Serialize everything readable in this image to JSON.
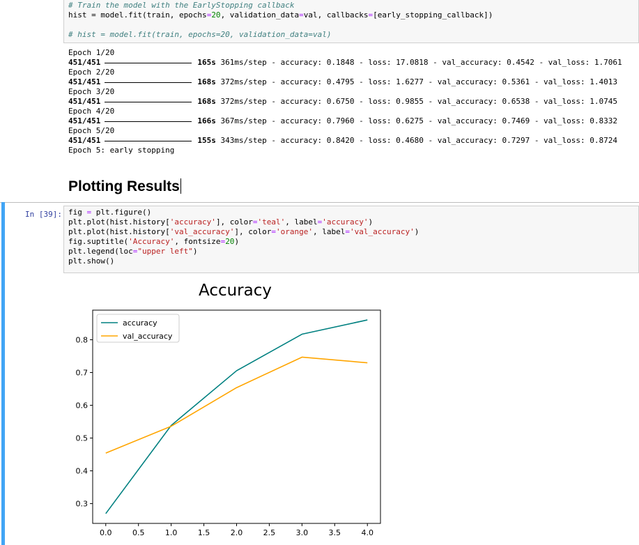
{
  "top_cell": {
    "comment1": "# Train the model with the EarlyStopping callback",
    "line2_a": "hist = model.fit(train, epochs",
    "line2_eq": "=",
    "line2_num": "20",
    "line2_b": ", validation_data",
    "line2_eq2": "=",
    "line2_c": "val, callbacks",
    "line2_eq3": "=",
    "line2_d": "[early_stopping_callback])",
    "comment2": "# hist = model.fit(train, epochs=20, validation_data=val)"
  },
  "output": {
    "epochs": [
      {
        "header": "Epoch 1/20",
        "steps": "451/451",
        "time": "165s",
        "rest": " 361ms/step - accuracy: 0.1848 - loss: 17.0818 - val_accuracy: 0.4542 - val_loss: 1.7061"
      },
      {
        "header": "Epoch 2/20",
        "steps": "451/451",
        "time": "168s",
        "rest": " 372ms/step - accuracy: 0.4795 - loss: 1.6277 - val_accuracy: 0.5361 - val_loss: 1.4013"
      },
      {
        "header": "Epoch 3/20",
        "steps": "451/451",
        "time": "168s",
        "rest": " 372ms/step - accuracy: 0.6750 - loss: 0.9855 - val_accuracy: 0.6538 - val_loss: 1.0745"
      },
      {
        "header": "Epoch 4/20",
        "steps": "451/451",
        "time": "166s",
        "rest": " 367ms/step - accuracy: 0.7960 - loss: 0.6275 - val_accuracy: 0.7469 - val_loss: 0.8332"
      },
      {
        "header": "Epoch 5/20",
        "steps": "451/451",
        "time": "155s",
        "rest": " 343ms/step - accuracy: 0.8420 - loss: 0.4680 - val_accuracy: 0.7297 - val_loss: 0.8724"
      }
    ],
    "final": "Epoch 5: early stopping"
  },
  "heading": "Plotting Results",
  "cell": {
    "prompt": "In [39]:",
    "lines": [
      [
        {
          "t": "fig ",
          "c": ""
        },
        {
          "t": "=",
          "c": "op"
        },
        {
          "t": " plt.figure()",
          "c": ""
        }
      ],
      [
        {
          "t": "plt.plot(hist.history[",
          "c": ""
        },
        {
          "t": "'accuracy'",
          "c": "str"
        },
        {
          "t": "], color",
          "c": ""
        },
        {
          "t": "=",
          "c": "op"
        },
        {
          "t": "'teal'",
          "c": "str"
        },
        {
          "t": ", label",
          "c": ""
        },
        {
          "t": "=",
          "c": "op"
        },
        {
          "t": "'accuracy'",
          "c": "str"
        },
        {
          "t": ")",
          "c": ""
        }
      ],
      [
        {
          "t": "plt.plot(hist.history[",
          "c": ""
        },
        {
          "t": "'val_accuracy'",
          "c": "str"
        },
        {
          "t": "], color",
          "c": ""
        },
        {
          "t": "=",
          "c": "op"
        },
        {
          "t": "'orange'",
          "c": "str"
        },
        {
          "t": ", label",
          "c": ""
        },
        {
          "t": "=",
          "c": "op"
        },
        {
          "t": "'val_accuracy'",
          "c": "str"
        },
        {
          "t": ")",
          "c": ""
        }
      ],
      [
        {
          "t": "fig.suptitle(",
          "c": ""
        },
        {
          "t": "'Accuracy'",
          "c": "str"
        },
        {
          "t": ", fontsize",
          "c": ""
        },
        {
          "t": "=",
          "c": "op"
        },
        {
          "t": "20",
          "c": "num"
        },
        {
          "t": ")",
          "c": ""
        }
      ],
      [
        {
          "t": "plt.legend(loc",
          "c": ""
        },
        {
          "t": "=",
          "c": "op"
        },
        {
          "t": "\"upper left\"",
          "c": "str"
        },
        {
          "t": ")",
          "c": ""
        }
      ],
      [
        {
          "t": "plt.show()",
          "c": ""
        }
      ]
    ]
  },
  "chart_data": {
    "type": "line",
    "title": "Accuracy",
    "x": [
      0,
      1,
      2,
      3,
      4
    ],
    "series": [
      {
        "name": "accuracy",
        "color": "#008080",
        "values": [
          0.2695,
          0.5385,
          0.7055,
          0.817,
          0.8605
        ]
      },
      {
        "name": "val_accuracy",
        "color": "#ffa500",
        "values": [
          0.4542,
          0.5361,
          0.6538,
          0.7469,
          0.7297
        ]
      }
    ],
    "xticks": [
      "0.0",
      "0.5",
      "1.0",
      "1.5",
      "2.0",
      "2.5",
      "3.0",
      "3.5",
      "4.0"
    ],
    "xtick_values": [
      0,
      0.5,
      1,
      1.5,
      2,
      2.5,
      3,
      3.5,
      4
    ],
    "yticks": [
      "0.3",
      "0.4",
      "0.5",
      "0.6",
      "0.7",
      "0.8"
    ],
    "ytick_values": [
      0.3,
      0.4,
      0.5,
      0.6,
      0.7,
      0.8
    ],
    "xlim": [
      -0.2,
      4.2
    ],
    "ylim": [
      0.2396,
      0.8904
    ],
    "legend": "upper left",
    "grid": false
  }
}
